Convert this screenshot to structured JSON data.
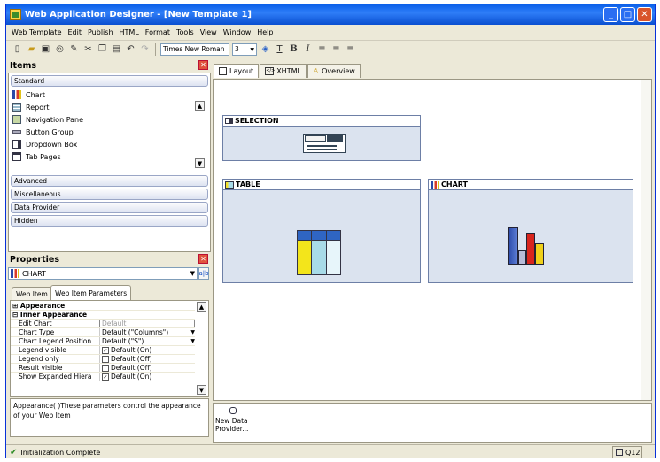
{
  "window": {
    "title": "Web Application Designer - [New Template 1]"
  },
  "menu": [
    "Web Template",
    "Edit",
    "Publish",
    "HTML",
    "Format",
    "Tools",
    "View",
    "Window",
    "Help"
  ],
  "toolbar": {
    "font": "Times New Roman",
    "size": "3",
    "bold": "B",
    "italic": "I"
  },
  "items_panel": {
    "title": "Items",
    "groups_top": [
      "Standard"
    ],
    "standard_items": [
      "Chart",
      "Report",
      "Navigation Pane",
      "Button Group",
      "Dropdown Box",
      "Tab Pages"
    ],
    "groups_bottom": [
      "Advanced",
      "Miscellaneous",
      "Data Provider",
      "Hidden"
    ]
  },
  "properties_panel": {
    "title": "Properties",
    "selected_item": "CHART",
    "tabs": [
      "Web Item",
      "Web Item Parameters"
    ],
    "sections": [
      "Appearance",
      "Inner Appearance"
    ],
    "rows": [
      {
        "key": "Edit Chart",
        "value": "Default",
        "type": "input"
      },
      {
        "key": "Chart Type",
        "value": "Default (\"Columns\")",
        "type": "select"
      },
      {
        "key": "Chart Legend Position",
        "value": "Default (\"S\")",
        "type": "select"
      },
      {
        "key": "Legend visible",
        "value": "Default (On)",
        "type": "checkbox",
        "checked": true
      },
      {
        "key": "Legend only",
        "value": "Default (Off)",
        "type": "checkbox",
        "checked": false
      },
      {
        "key": "Result visible",
        "value": "Default (Off)",
        "type": "checkbox",
        "checked": false
      },
      {
        "key": "Show  Expanded Hiera",
        "value": "Default (On)",
        "type": "checkbox",
        "checked": true
      }
    ],
    "description": "Appearance( )These parameters control the appearance of your Web Item"
  },
  "editor_tabs": [
    "Layout",
    "XHTML",
    "Overview"
  ],
  "canvas": {
    "selection_label": "SELECTION",
    "table_label": "TABLE",
    "chart_label": "CHART"
  },
  "bottom_panel": {
    "new_data_provider": "New Data Provider..."
  },
  "status": {
    "message": "Initialization Complete",
    "system": "Q12"
  },
  "colors": {
    "title_bar": "#0a5fe8",
    "window_bg": "#ece9d8",
    "widget_bg": "#dbe3ef"
  }
}
